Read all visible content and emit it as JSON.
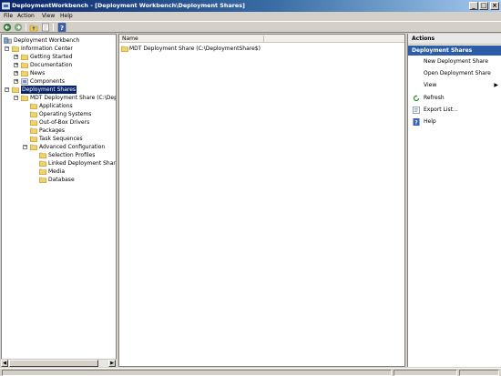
{
  "window": {
    "title": "DeploymentWorkbench - [Deployment Workbench\\Deployment Shares]"
  },
  "menu": {
    "file": "File",
    "action": "Action",
    "view": "View",
    "help": "Help"
  },
  "tree": {
    "root": "Deployment Workbench",
    "information_center": "Information Center",
    "getting_started": "Getting Started",
    "documentation": "Documentation",
    "news": "News",
    "components": "Components",
    "deployment_shares": "Deployment Shares",
    "mdt_share": "MDT Deployment Share (C:\\Deploym",
    "applications": "Applications",
    "operating_systems": "Operating Systems",
    "drivers": "Out-of-Box Drivers",
    "packages": "Packages",
    "task_sequences": "Task Sequences",
    "advanced_config": "Advanced Configuration",
    "selection_profiles": "Selection Profiles",
    "linked_shares": "Linked Deployment Shares",
    "media": "Media",
    "database": "Database"
  },
  "list": {
    "column_name": "Name",
    "rows": [
      "MDT Deployment Share (C:\\DeploymentShare$)"
    ]
  },
  "actions": {
    "header": "Actions",
    "section": "Deployment Shares",
    "new_share": "New Deployment Share",
    "open_share": "Open Deployment Share",
    "view": "View",
    "refresh": "Refresh",
    "export": "Export List...",
    "help": "Help"
  }
}
